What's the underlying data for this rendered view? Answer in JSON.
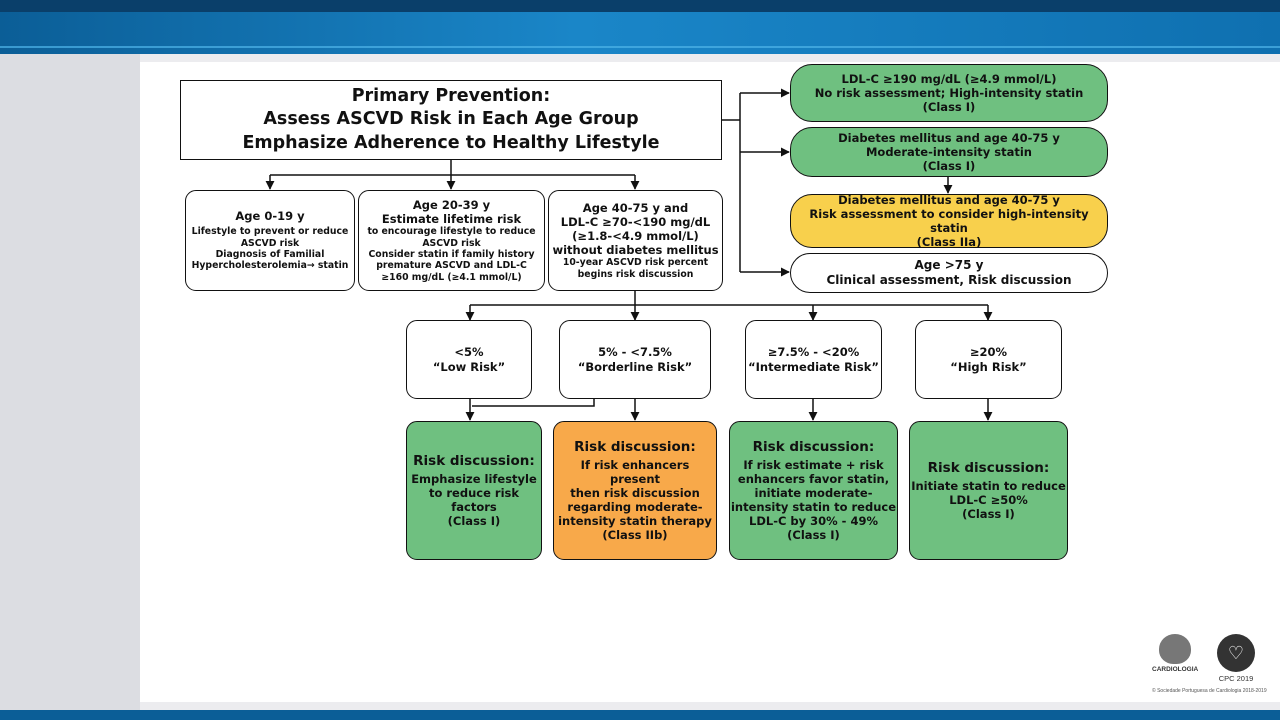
{
  "header": {
    "title_lines": [
      "Primary Prevention:",
      "Assess ASCVD Risk in Each Age Group",
      "Emphasize Adherence to Healthy Lifestyle"
    ]
  },
  "age_groups": [
    {
      "heading": "Age 0-19 y",
      "lines": [
        "Lifestyle to prevent or reduce",
        "ASCVD risk",
        "Diagnosis of Familial",
        "Hypercholesterolemia→ statin"
      ]
    },
    {
      "heading_lines": [
        "Age 20-39 y",
        "Estimate lifetime risk"
      ],
      "lines": [
        "to encourage lifestyle to reduce",
        "ASCVD risk",
        "Consider statin if family history",
        "premature ASCVD and LDL-C",
        "≥160 mg/dL (≥4.1 mmol/L)"
      ]
    },
    {
      "heading_lines": [
        "Age 40-75 y and",
        "LDL-C ≥70-<190 mg/dL",
        "(≥1.8-<4.9 mmol/L)",
        "without diabetes mellitus"
      ],
      "lines": [
        "10-year ASCVD risk percent",
        "begins risk discussion"
      ]
    }
  ],
  "right_column": [
    {
      "lines": [
        "LDL-C ≥190 mg/dL (≥4.9 mmol/L)",
        "No risk assessment; High-intensity statin",
        "(Class I)"
      ],
      "color": "#6fc080"
    },
    {
      "lines": [
        "Diabetes mellitus and age 40-75 y",
        "Moderate-intensity statin",
        "(Class I)"
      ],
      "color": "#6fc080"
    },
    {
      "lines": [
        "Diabetes mellitus and age 40-75 y",
        "Risk assessment to consider high-intensity statin",
        "(Class IIa)"
      ],
      "color": "#f8d04c"
    },
    {
      "lines": [
        "Age >75 y",
        "Clinical assessment, Risk discussion"
      ],
      "color": "#ffffff"
    }
  ],
  "risk_levels": [
    {
      "range": "<5%",
      "label": "“Low Risk”"
    },
    {
      "range": "5% - <7.5%",
      "label": "“Borderline Risk”"
    },
    {
      "range": "≥7.5% - <20%",
      "label": "“Intermediate Risk”"
    },
    {
      "range": "≥20%",
      "label": "“High Risk”"
    }
  ],
  "discussions": [
    {
      "heading": "Risk discussion:",
      "lines": [
        "Emphasize lifestyle",
        "to reduce risk",
        "factors",
        "(Class I)"
      ],
      "color": "#6fc080"
    },
    {
      "heading": "Risk discussion:",
      "lines": [
        "If risk enhancers present",
        "then risk discussion",
        "regarding moderate-",
        "intensity statin therapy",
        "(Class IIb)"
      ],
      "color": "#f8a94a"
    },
    {
      "heading": "Risk discussion:",
      "lines": [
        "If risk estimate + risk",
        "enhancers favor statin,",
        "initiate moderate-",
        "intensity statin to reduce",
        "LDL-C by 30% - 49%",
        "(Class I)"
      ],
      "color": "#6fc080"
    },
    {
      "heading": "Risk discussion:",
      "lines": [
        "Initiate statin to reduce",
        "LDL-C ≥50%",
        "(Class I)"
      ],
      "color": "#6fc080"
    }
  ],
  "logos": {
    "spc_text": "CARDIOLOGIA",
    "cpc_text": "CPC 2019",
    "copyright": "© Sociedade Portuguesa de Cardiologia 2018-2019"
  }
}
